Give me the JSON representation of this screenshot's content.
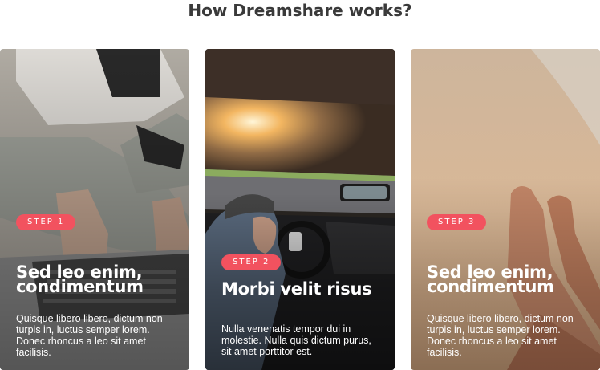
{
  "section": {
    "title": "How Dreamshare works?"
  },
  "cards": [
    {
      "step": "STEP 1",
      "heading": "Sed leo enim, condimentum",
      "text": "Quisque libero libero, dictum non turpis in, luctus semper lorem. Donec rhoncus a leo sit amet facilisis."
    },
    {
      "step": "STEP 2",
      "heading": "Morbi velit risus",
      "text": "Nulla venenatis tempor dui in molestie. Nulla quis dictum purus, sit amet porttitor est."
    },
    {
      "step": "STEP 3",
      "heading": "Sed leo enim, condimentum",
      "text": "Quisque libero libero, dictum non turpis in, luctus semper lorem. Donec rhoncus a leo sit amet facilisis."
    }
  ],
  "colors": {
    "badge": "#f2525f",
    "title": "#3a3a3a"
  }
}
